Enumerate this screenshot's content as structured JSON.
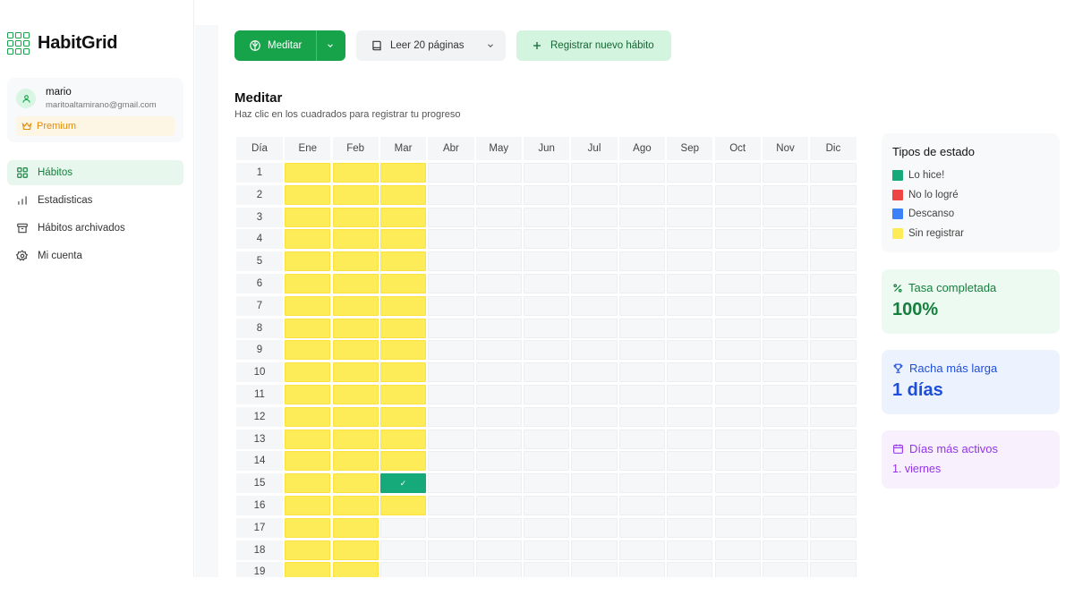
{
  "app": {
    "name": "HabitGrid"
  },
  "user": {
    "name": "mario",
    "email": "maritoaltamirano@gmail.com",
    "plan": "Premium"
  },
  "sidebar": {
    "items": [
      {
        "label": "Hábitos",
        "icon": "grid-icon",
        "active": true
      },
      {
        "label": "Estadisticas",
        "icon": "bar-chart-icon",
        "active": false
      },
      {
        "label": "Hábitos archivados",
        "icon": "archive-icon",
        "active": false
      },
      {
        "label": "Mi cuenta",
        "icon": "gear-icon",
        "active": false
      }
    ]
  },
  "toolbar": {
    "selected_habit": "Meditar",
    "secondary_habit": "Leer 20 páginas",
    "new_habit_label": "Registrar nuevo hábito"
  },
  "habit": {
    "title": "Meditar",
    "subtitle": "Haz clic en los cuadrados para registrar tu progreso"
  },
  "grid": {
    "day_header": "Día",
    "months": [
      "Ene",
      "Feb",
      "Mar",
      "Abr",
      "May",
      "Jun",
      "Jul",
      "Ago",
      "Sep",
      "Oct",
      "Nov",
      "Dic"
    ],
    "days": [
      1,
      2,
      3,
      4,
      5,
      6,
      7,
      8,
      9,
      10,
      11,
      12,
      13,
      14,
      15,
      16,
      17,
      18,
      19
    ],
    "status_by_month": {
      "Ene": [
        "pending",
        "pending",
        "pending",
        "pending",
        "pending",
        "pending",
        "pending",
        "pending",
        "pending",
        "pending",
        "pending",
        "pending",
        "pending",
        "pending",
        "pending",
        "pending",
        "pending",
        "pending",
        "pending"
      ],
      "Feb": [
        "pending",
        "pending",
        "pending",
        "pending",
        "pending",
        "pending",
        "pending",
        "pending",
        "pending",
        "pending",
        "pending",
        "pending",
        "pending",
        "pending",
        "pending",
        "pending",
        "pending",
        "pending",
        "pending"
      ],
      "Mar": [
        "pending",
        "pending",
        "pending",
        "pending",
        "pending",
        "pending",
        "pending",
        "pending",
        "pending",
        "pending",
        "pending",
        "pending",
        "pending",
        "pending",
        "done",
        "pending",
        "empty",
        "empty",
        "empty"
      ]
    },
    "check_glyph": "✓"
  },
  "legend": {
    "title": "Tipos de estado",
    "items": [
      {
        "label": "Lo hice!",
        "color": "#16a97a"
      },
      {
        "label": "No lo logré",
        "color": "#ef4444"
      },
      {
        "label": "Descanso",
        "color": "#3b82f6"
      },
      {
        "label": "Sin registrar",
        "color": "#fdec58"
      }
    ]
  },
  "stats": {
    "completion": {
      "label": "Tasa completada",
      "value": "100%",
      "icon": "percent-icon"
    },
    "streak": {
      "label": "Racha más larga",
      "value": "1 días",
      "icon": "trophy-icon"
    },
    "active_days": {
      "label": "Días más activos",
      "value": "1. viernes",
      "icon": "calendar-icon"
    }
  },
  "colors": {
    "accent": "#16a34a",
    "premium": "#e38b07",
    "done": "#16a97a",
    "failed": "#ef4444",
    "rest": "#3b82f6",
    "pending": "#fdec58"
  }
}
